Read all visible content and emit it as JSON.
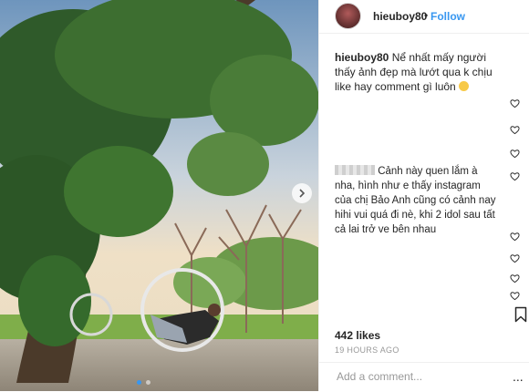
{
  "post": {
    "username": "hieuboy80",
    "follow_label": "Follow",
    "separator": "•",
    "caption_text": "Nể nhất mấy người thấy ảnh đẹp mà lướt qua k chịu like hay comment gì luôn",
    "comment_text": "Cảnh này quen lắm à nha, hình như e thấy instagram của chị Bảo Anh cũng có cảnh nay hihi vui quá đi nè, khi 2 idol sau tất cả lai trở ve bên nhau",
    "likes": "442 likes",
    "timestamp": "19 HOURS AGO",
    "add_comment_placeholder": "Add a comment...",
    "more_label": "..."
  },
  "carousel": {
    "total": 2,
    "active": 1
  },
  "icons": [
    "heart-icon",
    "bookmark-icon",
    "chevron-right-icon",
    "smile-emoji-icon"
  ],
  "colors": {
    "link": "#3897f0",
    "text": "#262626",
    "muted": "#999999",
    "border": "#efefef"
  }
}
